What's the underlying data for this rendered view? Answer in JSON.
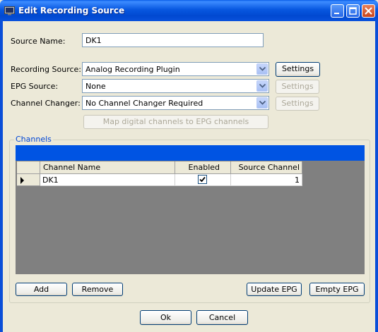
{
  "window": {
    "title": "Edit Recording Source"
  },
  "form": {
    "source_name": {
      "label": "Source Name:",
      "value": "DK1"
    },
    "recording_source": {
      "label": "Recording Source:",
      "value": "Analog Recording Plugin",
      "settings_label": "Settings"
    },
    "epg_source": {
      "label": "EPG Source:",
      "value": "None",
      "settings_label": "Settings"
    },
    "channel_changer": {
      "label": "Channel Changer:",
      "value": "No Channel Changer Required",
      "settings_label": "Settings"
    },
    "map_button_label": "Map digital channels to EPG channels"
  },
  "channels": {
    "group_title": "Channels",
    "columns": [
      "Channel Name",
      "Enabled",
      "Source Channel"
    ],
    "rows": [
      {
        "channel_name": "DK1",
        "enabled": true,
        "source_channel": "1"
      }
    ],
    "buttons": {
      "add": "Add",
      "remove": "Remove",
      "update_epg": "Update EPG",
      "empty_epg": "Empty EPG"
    }
  },
  "dialog_buttons": {
    "ok": "Ok",
    "cancel": "Cancel"
  },
  "icons": {
    "app": "recording-app-icon",
    "row_indicator": "row-pointer-icon",
    "checkbox": "checkbox-checked-icon"
  }
}
